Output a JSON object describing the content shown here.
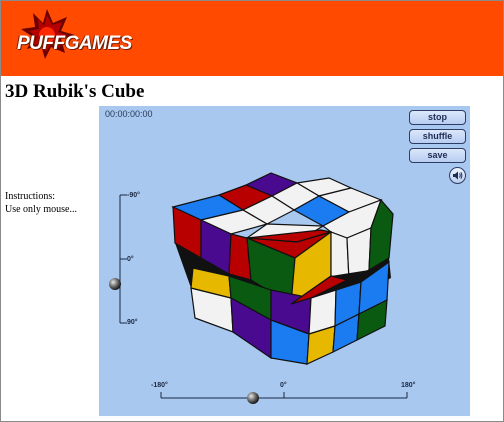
{
  "header": {
    "brand": "PUFFGAMES",
    "bg_color": "#ff4a00",
    "logo_icon": "puff-star-icon"
  },
  "page": {
    "title": "3D Rubik's Cube",
    "instructions_heading": "Instructions:",
    "instructions_body": "Use only mouse..."
  },
  "game": {
    "bg_color": "#a8c8f0",
    "timer": "00:00:00:00",
    "buttons": {
      "stop": "stop",
      "shuffle": "shuffle",
      "save": "save"
    },
    "sound_icon": "speaker-icon",
    "vertical_slider": {
      "labels": [
        "-90°",
        "0°",
        "90°"
      ],
      "value_deg": 0
    },
    "horizontal_slider": {
      "labels": [
        "-180°",
        "0°",
        "180°"
      ],
      "value_deg": -45
    },
    "cube_colors": {
      "red": "#b80000",
      "white": "#f2f2f2",
      "blue": "#1a7cf0",
      "purple": "#4a0a90",
      "green": "#0a5a12",
      "yellow": "#e6b800",
      "core": "#111111"
    }
  }
}
